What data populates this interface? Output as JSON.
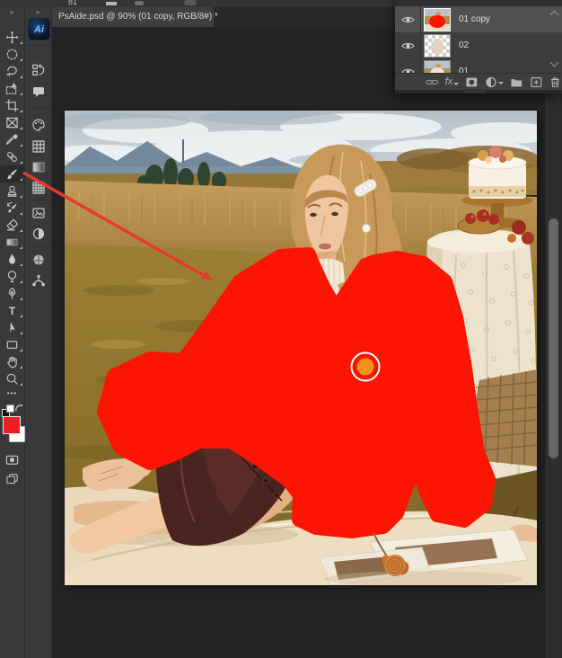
{
  "options_bar": {
    "brush_size_value": "81"
  },
  "tab_bar": {
    "tab_title": "PsAide.psd @ 90% (01 copy, RGB/8#) *",
    "close_glyph": "×"
  },
  "toolbar": {
    "expand_glyph": "»",
    "type_tool_glyph": "T",
    "more_glyph": "•••",
    "tools": [
      "Move Tool",
      "Elliptical Marquee Tool",
      "Lasso Tool",
      "Object Selection Tool",
      "Crop Tool",
      "Frame Tool",
      "Eyedropper Tool",
      "Spot Healing Brush Tool",
      "Brush Tool",
      "Clone Stamp Tool",
      "History Brush Tool",
      "Eraser Tool",
      "Gradient Tool",
      "Blur Tool",
      "Dodge Tool",
      "Pen Tool",
      "Horizontal Type Tool",
      "Path Selection Tool",
      "Rectangle Tool",
      "Hand Tool",
      "Zoom Tool",
      "Edit Toolbar"
    ],
    "selected_tool": "Brush Tool",
    "foreground_color": "#ee1c23",
    "background_color": "#ffffff"
  },
  "dock": {
    "ai_badge": "Ai",
    "icons": [
      "AI Plugin",
      "History",
      "Comments",
      "Color",
      "Swatches",
      "Gradients",
      "Patterns",
      "Libraries",
      "Adjustments",
      "Materials",
      "Paths"
    ]
  },
  "layers_panel": {
    "layers": [
      {
        "label": "01 copy",
        "selected": true,
        "visible": true
      },
      {
        "label": "02",
        "selected": false,
        "visible": true
      },
      {
        "label": "01",
        "selected": false,
        "visible": true
      }
    ],
    "footer": {
      "fx_label": "fx",
      "icons": [
        "Link Layers",
        "Layer Style",
        "Add Layer Mask",
        "Adjustment Layer",
        "New Group",
        "New Layer",
        "Delete Layer"
      ]
    }
  },
  "annotations": {
    "paint_color": "#fb1502",
    "arrow_color": "#e23b2c",
    "brush_dot_color": "#f6921e"
  }
}
